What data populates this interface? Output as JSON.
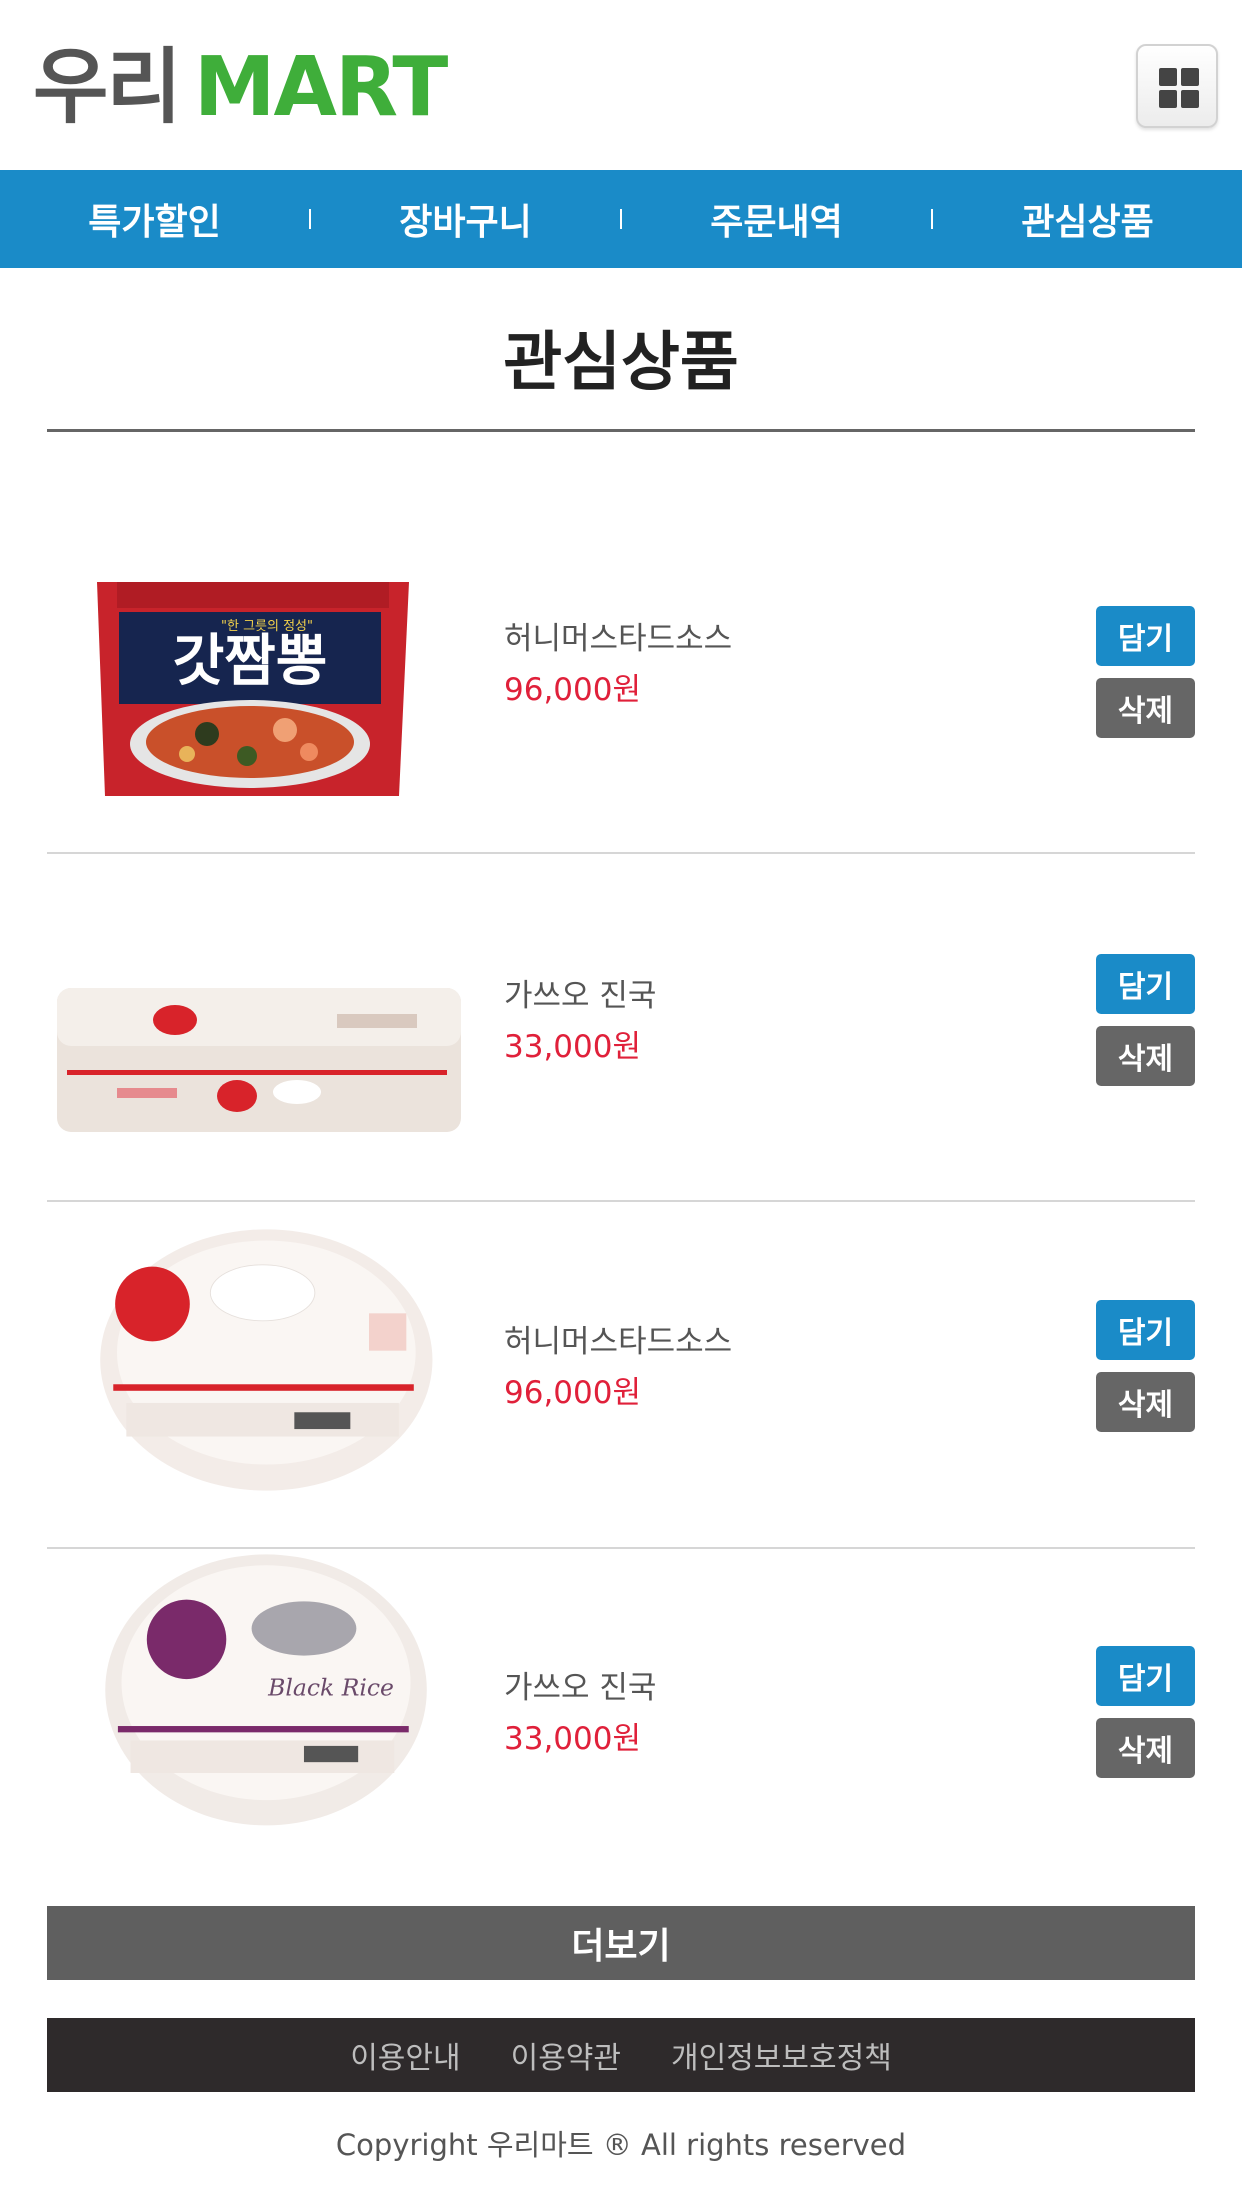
{
  "header": {
    "logo_part1": "우리",
    "logo_part2": "MART",
    "menu_icon": "grid-icon"
  },
  "nav": {
    "items": [
      {
        "label": "특가할인"
      },
      {
        "label": "장바구니"
      },
      {
        "label": "주문내역"
      },
      {
        "label": "관심상품"
      }
    ]
  },
  "page": {
    "title": "관심상품"
  },
  "products": [
    {
      "name": "허니머스타드소스",
      "price": "96,000원",
      "image": "ramen-package-image",
      "add_label": "담기",
      "delete_label": "삭제"
    },
    {
      "name": "가쓰오 진국",
      "price": "33,000원",
      "image": "rice-multipack-image",
      "add_label": "담기",
      "delete_label": "삭제"
    },
    {
      "name": "허니머스타드소스",
      "price": "96,000원",
      "image": "white-rice-bowl-image",
      "add_label": "담기",
      "delete_label": "삭제"
    },
    {
      "name": "가쓰오 진국",
      "price": "33,000원",
      "image": "black-rice-bowl-image",
      "add_label": "담기",
      "delete_label": "삭제"
    }
  ],
  "more_label": "더보기",
  "footer": {
    "links": [
      {
        "label": "이용안내"
      },
      {
        "label": "이용약관"
      },
      {
        "label": "개인정보보호정책"
      }
    ],
    "copyright": "Copyright 우리마트 ® All rights reserved"
  },
  "colors": {
    "brand_green": "#3fae3a",
    "nav_blue": "#1a8bc8",
    "price_red": "#e0203a",
    "delete_gray": "#666666",
    "footer_dark": "#2e2a2b"
  }
}
